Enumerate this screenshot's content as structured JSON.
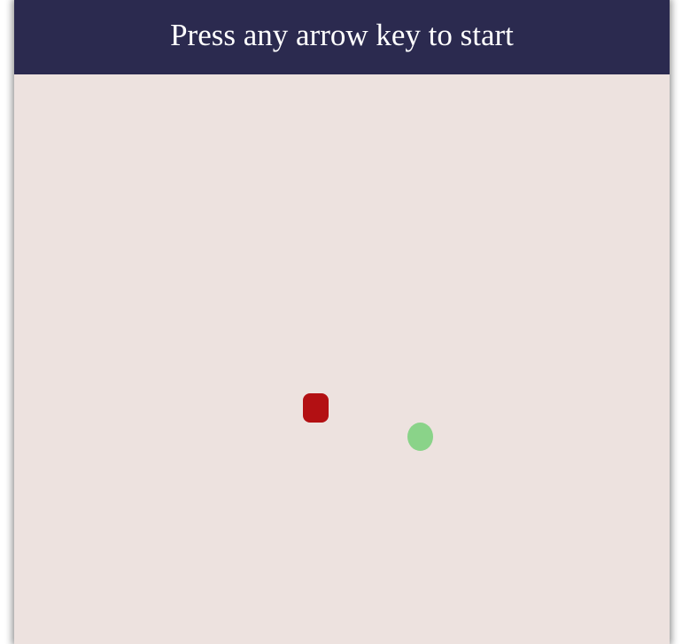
{
  "header": {
    "message": "Press any arrow key to start"
  },
  "colors": {
    "header_bg": "#2b2a4f",
    "board_bg": "#ede2df",
    "snake": "#b31013",
    "food": "#8ad389"
  },
  "game": {
    "snake_label": "snake-head",
    "food_label": "food"
  }
}
